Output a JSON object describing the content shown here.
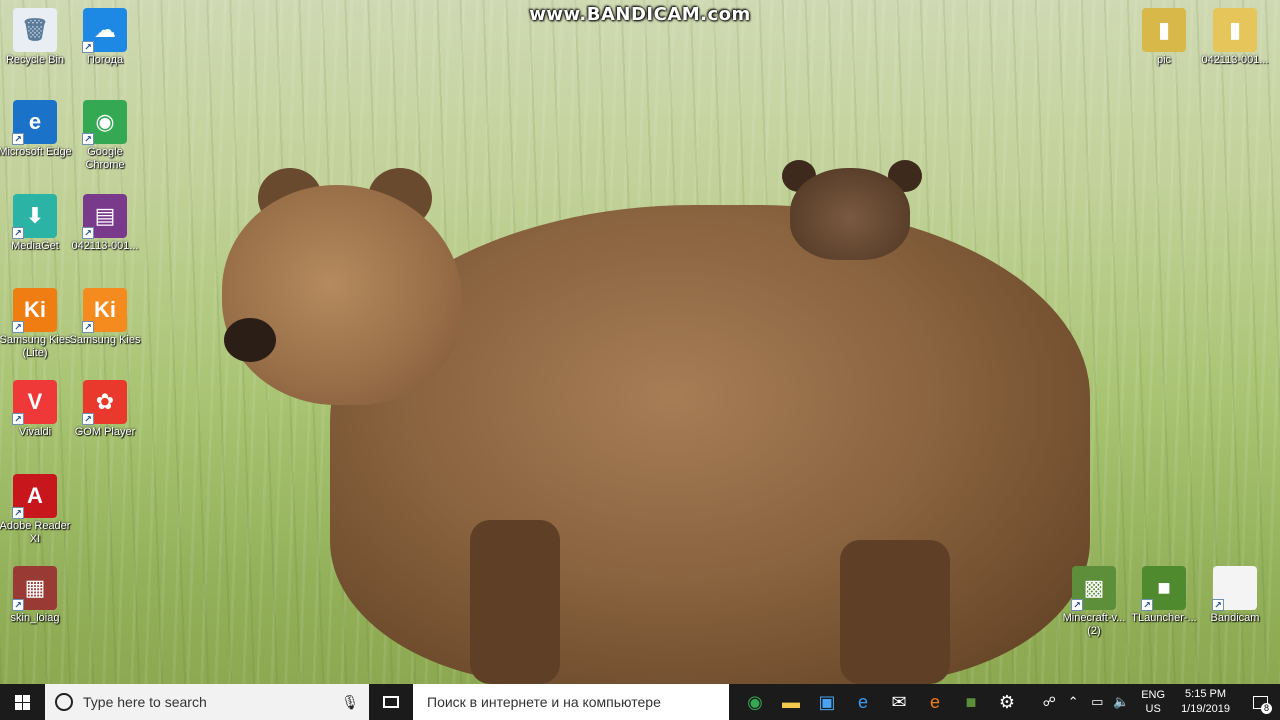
{
  "watermark": "www.BANDICAM.com",
  "desktop_icons_left": [
    {
      "label": "Recycle Bin",
      "icon": "recycle-bin-icon",
      "glyph": "🗑",
      "bg": "#e8eef4"
    },
    {
      "label": "Погода",
      "icon": "weather-cloud-icon",
      "glyph": "☁",
      "bg": "#1e88e5"
    },
    {
      "label": "Microsoft Edge",
      "icon": "edge-icon",
      "glyph": "e",
      "bg": "#1a73c8"
    },
    {
      "label": "Google Chrome",
      "icon": "chrome-icon",
      "glyph": "◉",
      "bg": "#34a853"
    },
    {
      "label": "MediaGet",
      "icon": "mediaget-icon",
      "glyph": "⬇",
      "bg": "#2bb3a6"
    },
    {
      "label": "042113-001...",
      "icon": "winrar-archive-icon",
      "glyph": "▤",
      "bg": "#7a3a8c"
    },
    {
      "label": "Samsung Kies (Lite)",
      "icon": "samsung-kies-lite-icon",
      "glyph": "Ki",
      "bg": "#f07d12"
    },
    {
      "label": "Samsung Kies",
      "icon": "samsung-kies-icon",
      "glyph": "Ki",
      "bg": "#f58a1f"
    },
    {
      "label": "Vivaldi",
      "icon": "vivaldi-icon",
      "glyph": "V",
      "bg": "#ef3939"
    },
    {
      "label": "GOM Player",
      "icon": "gom-player-icon",
      "glyph": "✿",
      "bg": "#e8392c"
    },
    {
      "label": "Adobe Reader XI",
      "icon": "adobe-reader-icon",
      "glyph": "A",
      "bg": "#c8161d"
    },
    {
      "label": "skin_loiag",
      "icon": "skin-image-icon",
      "glyph": "▦",
      "bg": "#9a3a34"
    }
  ],
  "desktop_icons_right_top": [
    {
      "label": "pic",
      "icon": "folder-pic-icon",
      "glyph": "▮",
      "bg": "#d9b84a"
    },
    {
      "label": "042113-001...",
      "icon": "folder-icon",
      "glyph": "▮",
      "bg": "#e6c55a"
    }
  ],
  "desktop_icons_right_bottom": [
    {
      "label": "Minecraft-v... (2)",
      "icon": "minecraft-installer-icon",
      "glyph": "▩",
      "bg": "#5d8f3a"
    },
    {
      "label": "TLauncher-...",
      "icon": "tlauncher-icon",
      "glyph": "■",
      "bg": "#4f8a2f"
    },
    {
      "label": "Bandicam",
      "icon": "file-icon",
      "glyph": "",
      "bg": "#f4f4f4"
    }
  ],
  "taskbar": {
    "search_placeholder": "Type here to search",
    "web_search_text": "Поиск в интернете и на компьютере",
    "apps": [
      {
        "icon": "chrome-icon",
        "glyph": "◉",
        "color": "#34a853"
      },
      {
        "icon": "file-explorer-icon",
        "glyph": "▬",
        "color": "#f2c94c"
      },
      {
        "icon": "store-icon",
        "glyph": "▣",
        "color": "#4aa3f0"
      },
      {
        "icon": "edge-icon",
        "glyph": "e",
        "color": "#3b9bf0"
      },
      {
        "icon": "mail-icon",
        "glyph": "✉",
        "color": "#ffffff"
      },
      {
        "icon": "browser-orange-icon",
        "glyph": "e",
        "color": "#f07d12"
      },
      {
        "icon": "minecraft-icon",
        "glyph": "■",
        "color": "#5d8f3a"
      },
      {
        "icon": "settings-gear-icon",
        "glyph": "⚙",
        "color": "#ffffff"
      }
    ],
    "lang_top": "ENG",
    "lang_bottom": "US",
    "time": "5:15 PM",
    "date": "1/19/2019",
    "notification_count": "8"
  }
}
